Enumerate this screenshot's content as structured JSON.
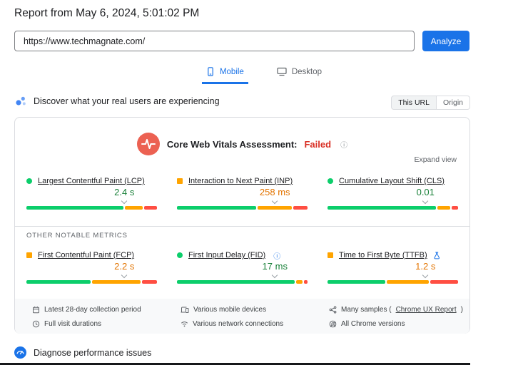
{
  "page": {
    "title": "Report from May 6, 2024, 5:01:02 PM"
  },
  "url_bar": {
    "value": "https://www.techmagnate.com/",
    "analyze_label": "Analyze"
  },
  "tabs": [
    {
      "label": "Mobile",
      "icon": "smartphone-icon",
      "active": true
    },
    {
      "label": "Desktop",
      "icon": "desktop-icon",
      "active": false
    }
  ],
  "field_section": {
    "heading": "Discover what your real users are experiencing",
    "scope_toggle": [
      {
        "label": "This URL",
        "active": true
      },
      {
        "label": "Origin",
        "active": false
      }
    ]
  },
  "card": {
    "assessment_label": "Core Web Vitals Assessment:",
    "assessment_value": "Failed",
    "expand_label": "Expand view",
    "other_metrics_label": "OTHER NOTABLE METRICS",
    "vitals": [
      {
        "name": "Largest Contentful Paint (LCP)",
        "value": "2.4 s",
        "rating": "good",
        "distribution": {
          "good": 76,
          "ni": 14,
          "poor": 10
        },
        "marker": 75
      },
      {
        "name": "Interaction to Next Paint (INP)",
        "value": "258 ms",
        "rating": "ni",
        "distribution": {
          "good": 62,
          "ni": 27,
          "poor": 11
        },
        "marker": 75
      },
      {
        "name": "Cumulative Layout Shift (CLS)",
        "value": "0.01",
        "rating": "good",
        "distribution": {
          "good": 85,
          "ni": 10,
          "poor": 5
        },
        "marker": 75
      }
    ],
    "other_metrics": [
      {
        "name": "First Contentful Paint (FCP)",
        "value": "2.2 s",
        "rating": "ni",
        "distribution": {
          "good": 50,
          "ni": 38,
          "poor": 12
        },
        "marker": 75
      },
      {
        "name": "First Input Delay (FID)",
        "value": "17 ms",
        "rating": "good",
        "distribution": {
          "good": 92,
          "ni": 5,
          "poor": 3
        },
        "marker": 75
      },
      {
        "name": "Time to First Byte (TTFB)",
        "value": "1.2 s",
        "rating": "ni",
        "distribution": {
          "good": 45,
          "ni": 33,
          "poor": 22
        },
        "marker": 75
      }
    ],
    "footer": [
      {
        "icon": "calendar-icon",
        "text": "Latest 28-day collection period"
      },
      {
        "icon": "devices-icon",
        "text": "Various mobile devices"
      },
      {
        "icon": "samples-icon",
        "prefix": "Many samples (",
        "link": "Chrome UX Report",
        "suffix": ")"
      },
      {
        "icon": "clock-icon",
        "text": "Full visit durations"
      },
      {
        "icon": "network-icon",
        "text": "Various network connections"
      },
      {
        "icon": "chrome-icon",
        "text": "All Chrome versions"
      }
    ]
  },
  "diagnose_section": {
    "heading": "Diagnose performance issues"
  },
  "colors": {
    "good": "#188038",
    "ni": "#e37400",
    "poor": "#d93025",
    "bar_good": "#0cce6b",
    "bar_ni": "#ffa400",
    "bar_poor": "#ff4e42",
    "accent": "#1a73e8",
    "failed": "#d93025"
  }
}
